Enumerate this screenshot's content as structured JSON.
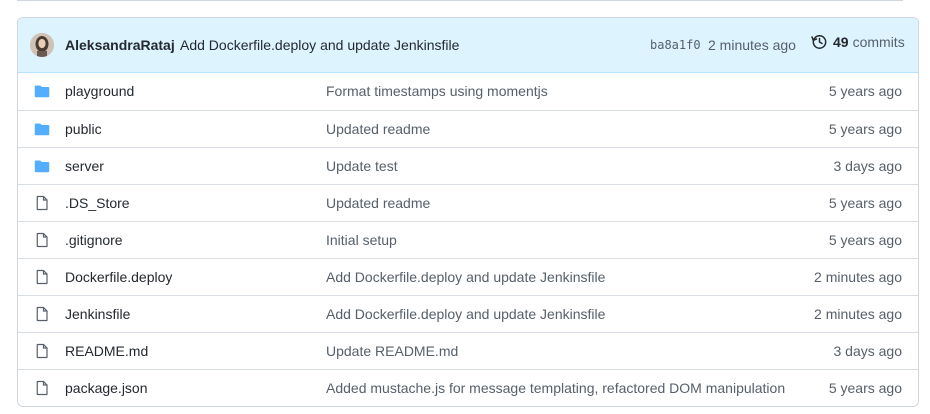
{
  "latest_commit": {
    "author": "AleksandraRataj",
    "message": "Add Dockerfile.deploy and update Jenkinsfile",
    "sha": "ba8a1f0",
    "time": "2 minutes ago",
    "history_icon": "history-icon",
    "commit_count": "49",
    "commits_label": "commits"
  },
  "colors": {
    "folder": "#54aeff",
    "file": "#57606a",
    "header_bg": "#ddf4ff"
  },
  "files": [
    {
      "type": "folder",
      "icon": "folder-icon",
      "name": "playground",
      "message": "Format timestamps using momentjs",
      "age": "5 years ago"
    },
    {
      "type": "folder",
      "icon": "folder-icon",
      "name": "public",
      "message": "Updated readme",
      "age": "5 years ago"
    },
    {
      "type": "folder",
      "icon": "folder-icon",
      "name": "server",
      "message": "Update test",
      "age": "3 days ago"
    },
    {
      "type": "file",
      "icon": "file-icon",
      "name": ".DS_Store",
      "message": "Updated readme",
      "age": "5 years ago"
    },
    {
      "type": "file",
      "icon": "file-icon",
      "name": ".gitignore",
      "message": "Initial setup",
      "age": "5 years ago"
    },
    {
      "type": "file",
      "icon": "file-icon",
      "name": "Dockerfile.deploy",
      "message": "Add Dockerfile.deploy and update Jenkinsfile",
      "age": "2 minutes ago"
    },
    {
      "type": "file",
      "icon": "file-icon",
      "name": "Jenkinsfile",
      "message": "Add Dockerfile.deploy and update Jenkinsfile",
      "age": "2 minutes ago"
    },
    {
      "type": "file",
      "icon": "file-icon",
      "name": "README.md",
      "message": "Update README.md",
      "age": "3 days ago"
    },
    {
      "type": "file",
      "icon": "file-icon",
      "name": "package.json",
      "message": "Added mustache.js for message templating, refactored DOM manipulation",
      "age": "5 years ago"
    }
  ]
}
